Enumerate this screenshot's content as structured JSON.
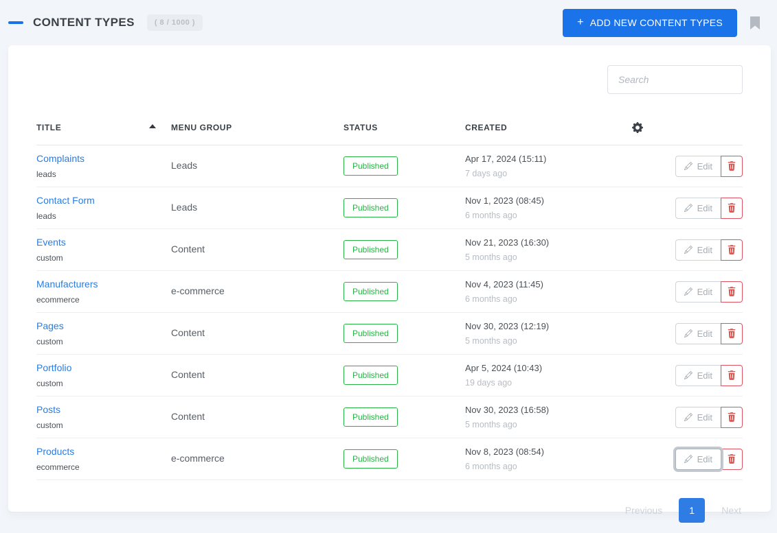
{
  "header": {
    "title": "CONTENT TYPES",
    "count_badge": "( 8 / 1000 )",
    "add_button_plus": "+",
    "add_button_label": "ADD NEW CONTENT TYPES"
  },
  "toolbar": {
    "search_placeholder": "Search"
  },
  "table": {
    "columns": {
      "title": "TITLE",
      "menu_group": "MENU GROUP",
      "status": "STATUS",
      "created": "CREATED"
    },
    "edit_label": "Edit",
    "rows": [
      {
        "title": "Complaints",
        "slug": "leads",
        "menu_group": "Leads",
        "status": "Published",
        "created": "Apr 17, 2024 (15:11)",
        "ago": "7 days ago"
      },
      {
        "title": "Contact Form",
        "slug": "leads",
        "menu_group": "Leads",
        "status": "Published",
        "created": "Nov 1, 2023 (08:45)",
        "ago": "6 months ago"
      },
      {
        "title": "Events",
        "slug": "custom",
        "menu_group": "Content",
        "status": "Published",
        "created": "Nov 21, 2023 (16:30)",
        "ago": "5 months ago"
      },
      {
        "title": "Manufacturers",
        "slug": "ecommerce",
        "menu_group": "e-commerce",
        "status": "Published",
        "created": "Nov 4, 2023 (11:45)",
        "ago": "6 months ago"
      },
      {
        "title": "Pages",
        "slug": "custom",
        "menu_group": "Content",
        "status": "Published",
        "created": "Nov 30, 2023 (12:19)",
        "ago": "5 months ago"
      },
      {
        "title": "Portfolio",
        "slug": "custom",
        "menu_group": "Content",
        "status": "Published",
        "created": "Apr 5, 2024 (10:43)",
        "ago": "19 days ago"
      },
      {
        "title": "Posts",
        "slug": "custom",
        "menu_group": "Content",
        "status": "Published",
        "created": "Nov 30, 2023 (16:58)",
        "ago": "5 months ago"
      },
      {
        "title": "Products",
        "slug": "ecommerce",
        "menu_group": "e-commerce",
        "status": "Published",
        "created": "Nov 8, 2023 (08:54)",
        "ago": "6 months ago"
      }
    ]
  },
  "pagination": {
    "previous": "Previous",
    "current_page": "1",
    "next": "Next"
  },
  "colors": {
    "accent_blue": "#1a73e8",
    "link_blue": "#2a7ce0",
    "status_green": "#28b445",
    "danger_red": "#de5362",
    "page_background": "#f2f5f9"
  }
}
